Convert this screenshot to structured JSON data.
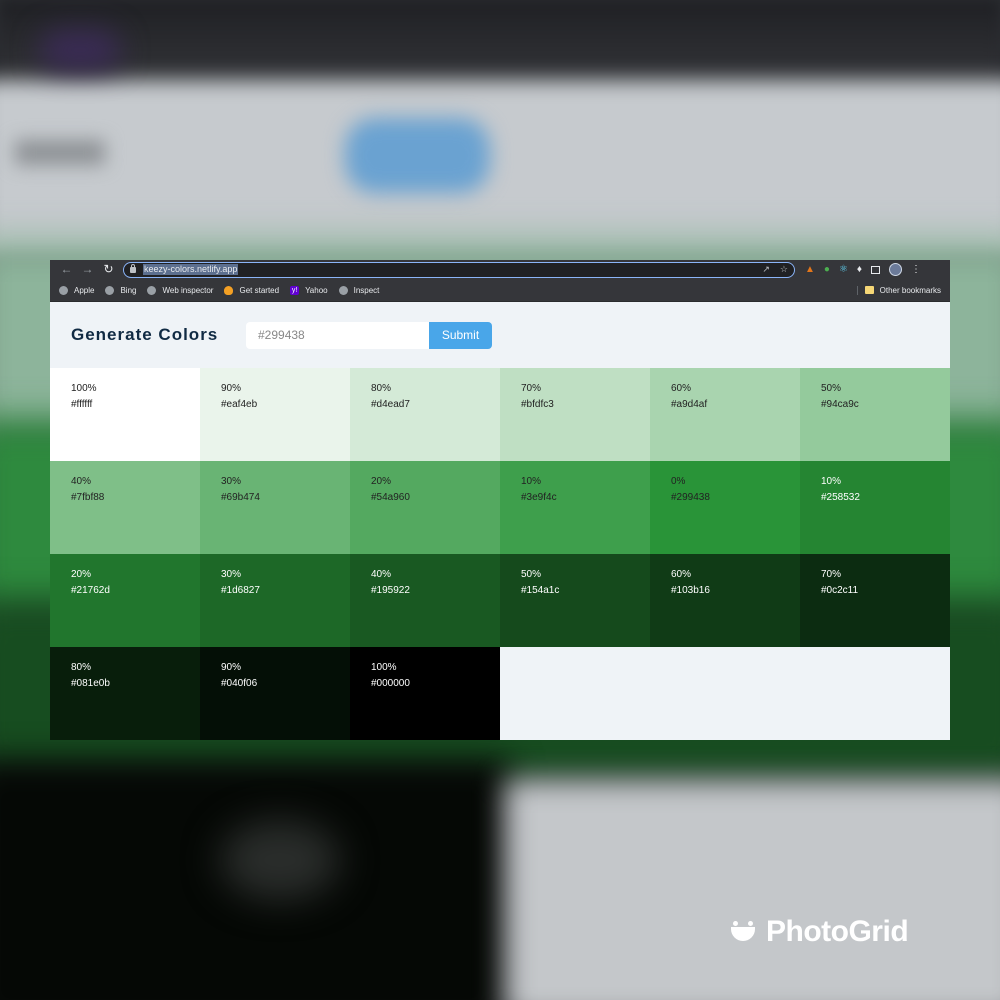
{
  "browser": {
    "url": "keezy-colors.netlify.app",
    "bookmarks": [
      "Apple",
      "Bing",
      "Web inspector",
      "Get started",
      "Yahoo",
      "Inspect"
    ],
    "other_bookmarks": "Other bookmarks"
  },
  "app": {
    "title": "Generate Colors",
    "input_placeholder": "#299438",
    "submit_label": "Submit"
  },
  "swatches": [
    {
      "weight": "100%",
      "hex": "#ffffff",
      "color": "#ffffff",
      "text": "light"
    },
    {
      "weight": "90%",
      "hex": "#eaf4eb",
      "color": "#eaf4eb",
      "text": "light"
    },
    {
      "weight": "80%",
      "hex": "#d4ead7",
      "color": "#d4ead7",
      "text": "light"
    },
    {
      "weight": "70%",
      "hex": "#bfdfc3",
      "color": "#bfdfc3",
      "text": "light"
    },
    {
      "weight": "60%",
      "hex": "#a9d4af",
      "color": "#a9d4af",
      "text": "light"
    },
    {
      "weight": "50%",
      "hex": "#94ca9c",
      "color": "#94ca9c",
      "text": "light"
    },
    {
      "weight": "40%",
      "hex": "#7fbf88",
      "color": "#7fbf88",
      "text": "light"
    },
    {
      "weight": "30%",
      "hex": "#69b474",
      "color": "#69b474",
      "text": "light"
    },
    {
      "weight": "20%",
      "hex": "#54a960",
      "color": "#54a960",
      "text": "light"
    },
    {
      "weight": "10%",
      "hex": "#3e9f4c",
      "color": "#3e9f4c",
      "text": "light"
    },
    {
      "weight": "0%",
      "hex": "#299438",
      "color": "#299438",
      "text": "light"
    },
    {
      "weight": "10%",
      "hex": "#258532",
      "color": "#258532",
      "text": "dark"
    },
    {
      "weight": "20%",
      "hex": "#21762d",
      "color": "#21762d",
      "text": "dark"
    },
    {
      "weight": "30%",
      "hex": "#1d6827",
      "color": "#1d6827",
      "text": "dark"
    },
    {
      "weight": "40%",
      "hex": "#195922",
      "color": "#195922",
      "text": "dark"
    },
    {
      "weight": "50%",
      "hex": "#154a1c",
      "color": "#154a1c",
      "text": "dark"
    },
    {
      "weight": "60%",
      "hex": "#103b16",
      "color": "#103b16",
      "text": "dark"
    },
    {
      "weight": "70%",
      "hex": "#0c2c11",
      "color": "#0c2c11",
      "text": "dark"
    },
    {
      "weight": "80%",
      "hex": "#081e0b",
      "color": "#081e0b",
      "text": "dark"
    },
    {
      "weight": "90%",
      "hex": "#040f06",
      "color": "#040f06",
      "text": "dark"
    },
    {
      "weight": "100%",
      "hex": "#000000",
      "color": "#000000",
      "text": "dark"
    }
  ],
  "watermark": "PhotoGrid"
}
